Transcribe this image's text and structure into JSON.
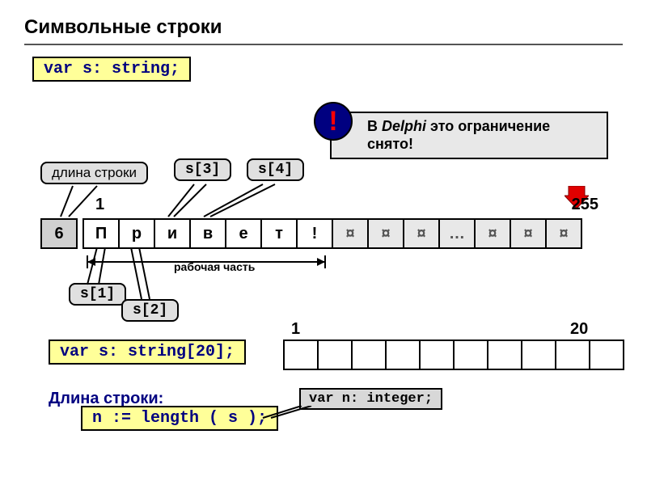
{
  "title": "Символьные строки",
  "decl1": "var s: string;",
  "note": {
    "prefix": "В ",
    "em": "Delphi",
    "rest": " это ограничение снято!"
  },
  "bang": "!",
  "tags": {
    "lenstr": "длина строки",
    "s1": "s[1]",
    "s2": "s[2]",
    "s3": "s[3]",
    "s4": "s[4]"
  },
  "nums": {
    "one": "1",
    "max": "255",
    "one2": "1",
    "twenty": "20"
  },
  "cells": [
    "6",
    "П",
    "р",
    "и",
    "в",
    "е",
    "т",
    "!",
    "¤",
    "¤",
    "¤",
    "…",
    "¤",
    "¤",
    "¤"
  ],
  "work": "рабочая часть",
  "decl2": "var s: string[20];",
  "lenlabel": "Длина строки:",
  "lenexpr": "n := length ( s );",
  "vardecl": "var n: integer;"
}
